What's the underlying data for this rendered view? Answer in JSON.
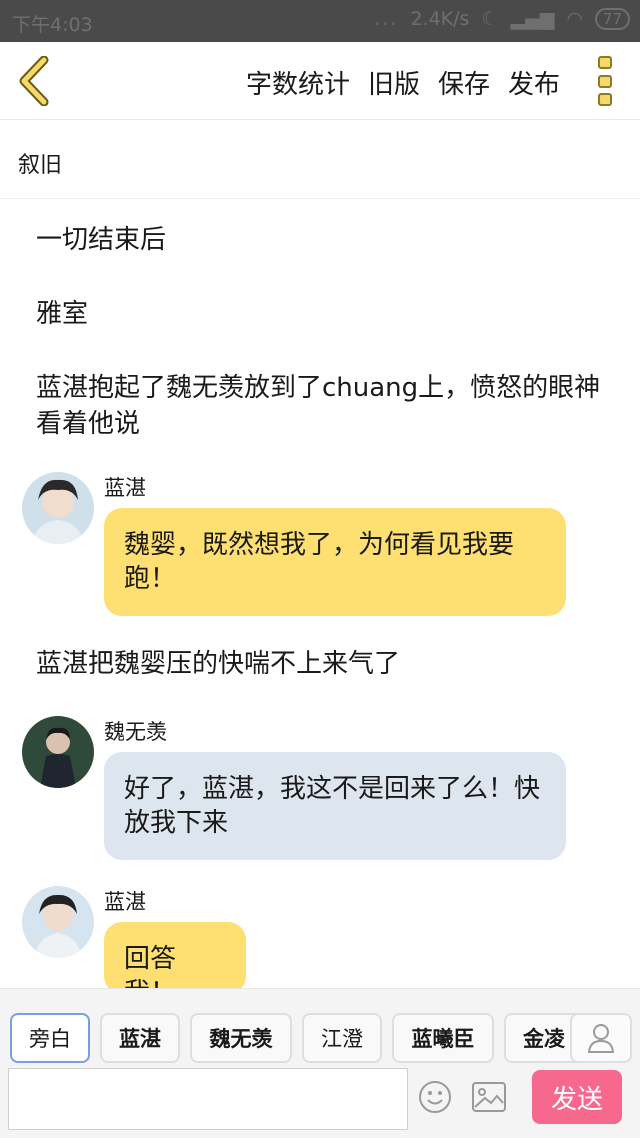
{
  "status_bar": {
    "time": "下午4:03",
    "dots": "...",
    "net_speed": "2.4K/s",
    "battery": "77"
  },
  "toolbar": {
    "word_count_label": "字数统计",
    "old_version_label": "旧版",
    "save_label": "保存",
    "publish_label": "发布",
    "icons": [
      "back-chevron-icon",
      "more-menu-icon"
    ],
    "accent_color": "#f6d96a"
  },
  "chapter": {
    "title": "叙旧"
  },
  "content": {
    "para_1": "一切结束后",
    "para_2": "雅室",
    "para_3": "蓝湛抱起了魏无羡放到了chuang上，愤怒的眼神看着他说",
    "msg_1": {
      "name": "蓝湛",
      "text": "魏婴，既然想我了，为何看见我要跑！"
    },
    "para_4": "蓝湛把魏婴压的快喘不上来气了",
    "msg_2": {
      "name": "魏无羡",
      "text": "好了，蓝湛，我这不是回来了么！快放我下来"
    },
    "msg_3": {
      "name": "蓝湛",
      "text": "回答我！"
    }
  },
  "characters": {
    "items": [
      "旁白",
      "蓝湛",
      "魏无羡",
      "江澄",
      "蓝曦臣",
      "金凌"
    ],
    "selected": "旁白"
  },
  "composer": {
    "placeholder": "",
    "send_label": "发送",
    "send_color": "#f7688f"
  }
}
